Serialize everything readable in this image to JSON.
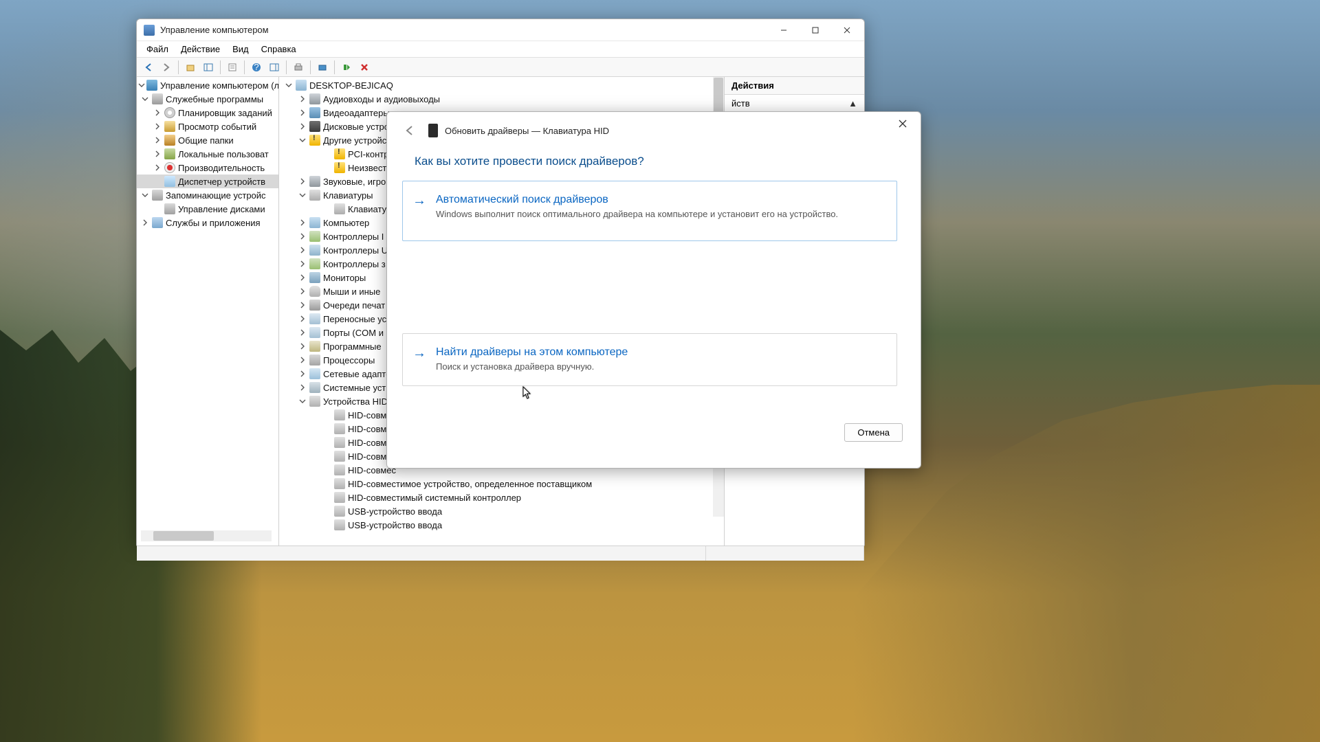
{
  "mmc": {
    "title": "Управление компьютером",
    "menus": [
      "Файл",
      "Действие",
      "Вид",
      "Справка"
    ],
    "left_tree": {
      "root": "Управление компьютером (л",
      "groups": [
        {
          "label": "Служебные программы",
          "expanded": true,
          "icon": "ic-tools",
          "children": [
            {
              "label": "Планировщик заданий",
              "icon": "ic-sched",
              "tw": true
            },
            {
              "label": "Просмотр событий",
              "icon": "ic-event",
              "tw": true
            },
            {
              "label": "Общие папки",
              "icon": "ic-share",
              "tw": true
            },
            {
              "label": "Локальные пользоват",
              "icon": "ic-users",
              "tw": true
            },
            {
              "label": "Производительность",
              "icon": "ic-perf",
              "tw": true
            },
            {
              "label": "Диспетчер устройств",
              "icon": "ic-devmgr",
              "selected": true
            }
          ]
        },
        {
          "label": "Запоминающие устройс",
          "expanded": true,
          "icon": "ic-disk",
          "children": [
            {
              "label": "Управление дисками",
              "icon": "ic-disk"
            }
          ]
        },
        {
          "label": "Службы и приложения",
          "expanded": false,
          "icon": "ic-svc",
          "tw": true
        }
      ]
    },
    "dev_tree": {
      "host": "DESKTOP-BEJICAQ",
      "categories": [
        {
          "label": "Аудиовходы и аудиовыходы",
          "icon": "ic-audio",
          "tw": true
        },
        {
          "label": "Видеоадаптеры",
          "icon": "ic-display",
          "tw": true
        },
        {
          "label": "Дисковые устро",
          "icon": "ic-drive",
          "tw": true
        },
        {
          "label": "Другие устройс",
          "icon": "ic-warn",
          "tw": true,
          "expanded": true,
          "children": [
            {
              "label": "PCI-контрол",
              "icon": "ic-warn"
            },
            {
              "label": "Неизвестно",
              "icon": "ic-warn"
            }
          ]
        },
        {
          "label": "Звуковые, игро",
          "icon": "ic-audio",
          "tw": true
        },
        {
          "label": "Клавиатуры",
          "icon": "ic-kbd",
          "tw": true,
          "expanded": true,
          "children": [
            {
              "label": "Клавиатура",
              "icon": "ic-kbd"
            }
          ]
        },
        {
          "label": "Компьютер",
          "icon": "ic-pc",
          "tw": true
        },
        {
          "label": "Контроллеры I",
          "icon": "ic-ctrl",
          "tw": true
        },
        {
          "label": "Контроллеры U",
          "icon": "ic-usb",
          "tw": true
        },
        {
          "label": "Контроллеры з",
          "icon": "ic-ctrl",
          "tw": true
        },
        {
          "label": "Мониторы",
          "icon": "ic-mon",
          "tw": true
        },
        {
          "label": "Мыши и иные",
          "icon": "ic-mouse",
          "tw": true
        },
        {
          "label": "Очереди печат",
          "icon": "ic-print",
          "tw": true
        },
        {
          "label": "Переносные ус",
          "icon": "ic-port",
          "tw": true
        },
        {
          "label": "Порты (COM и",
          "icon": "ic-port",
          "tw": true
        },
        {
          "label": "Программные",
          "icon": "ic-soft",
          "tw": true
        },
        {
          "label": "Процессоры",
          "icon": "ic-cpu",
          "tw": true
        },
        {
          "label": "Сетевые адапте",
          "icon": "ic-net",
          "tw": true
        },
        {
          "label": "Системные уст",
          "icon": "ic-sys",
          "tw": true
        },
        {
          "label": "Устройства HID",
          "icon": "ic-hid",
          "tw": true,
          "expanded": true,
          "children": [
            {
              "label": "HID-совмес",
              "icon": "ic-hid"
            },
            {
              "label": "HID-совмес",
              "icon": "ic-hid"
            },
            {
              "label": "HID-совмес",
              "icon": "ic-hid"
            },
            {
              "label": "HID-совмес",
              "icon": "ic-hid"
            },
            {
              "label": "HID-совмес",
              "icon": "ic-hid"
            },
            {
              "label": "HID-совместимое устройство, определенное поставщиком",
              "icon": "ic-hid"
            },
            {
              "label": "HID-совместимый системный контроллер",
              "icon": "ic-hid"
            },
            {
              "label": "USB-устройство ввода",
              "icon": "ic-hid"
            },
            {
              "label": "USB-устройство ввода",
              "icon": "ic-hid"
            }
          ]
        }
      ]
    },
    "actions": {
      "header": "Действия",
      "sub": "йств"
    }
  },
  "dialog": {
    "title": "Обновить драйверы — Клавиатура HID",
    "heading": "Как вы хотите провести поиск драйверов?",
    "opt1": {
      "title": "Автоматический поиск драйверов",
      "desc": "Windows выполнит поиск оптимального драйвера на компьютере и установит его на устройство."
    },
    "opt2": {
      "title": "Найти драйверы на этом компьютере",
      "desc": "Поиск и установка драйвера вручную."
    },
    "cancel": "Отмена"
  }
}
